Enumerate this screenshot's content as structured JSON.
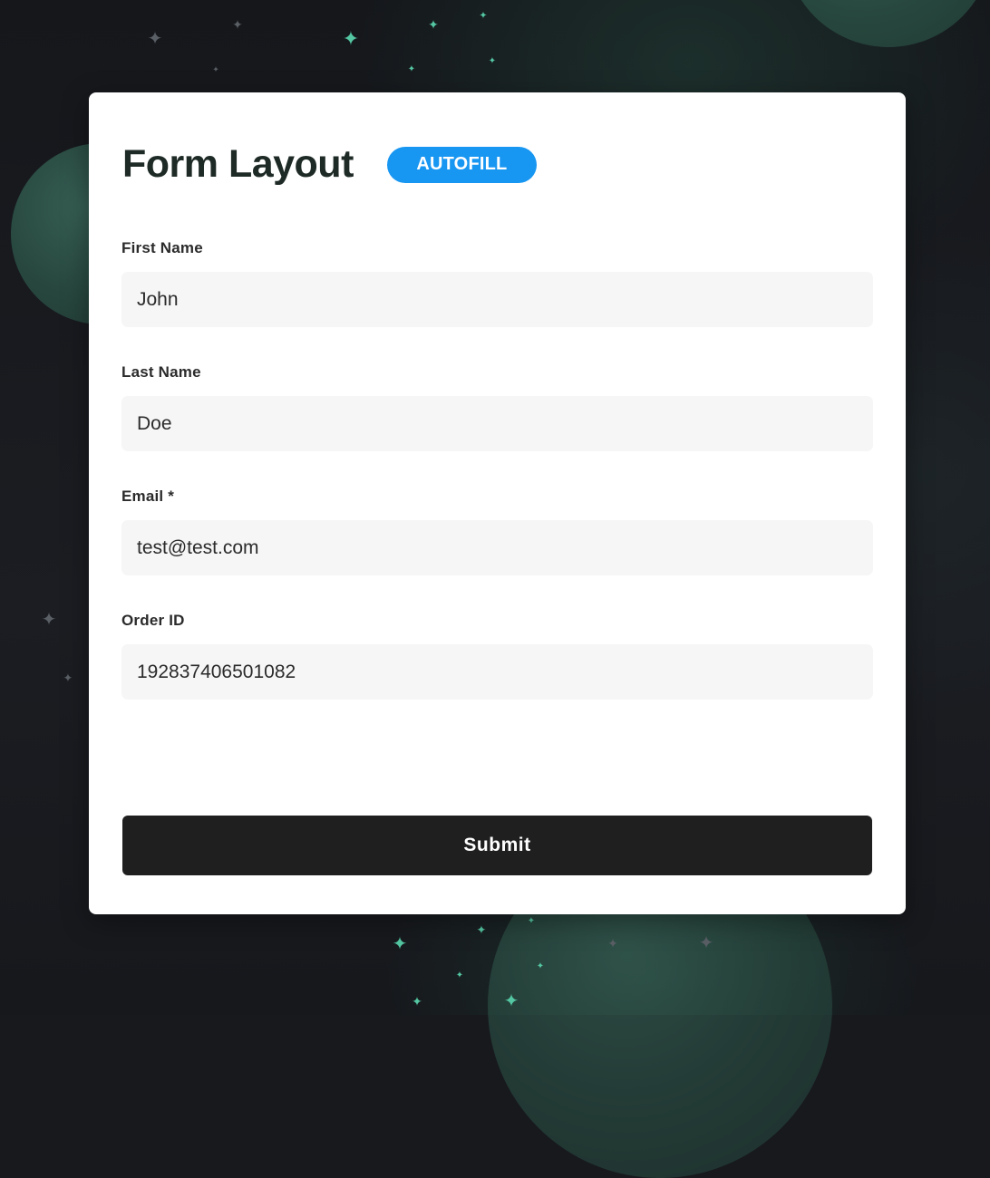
{
  "form": {
    "title": "Form Layout",
    "autofill_label": "AUTOFILL",
    "fields": [
      {
        "label": "First Name",
        "value": "John"
      },
      {
        "label": "Last Name",
        "value": "Doe"
      },
      {
        "label": "Email *",
        "value": "test@test.com"
      },
      {
        "label": "Order ID",
        "value": "192837406501082"
      }
    ],
    "submit_label": "Submit"
  },
  "theme": {
    "background": "#17191d",
    "card": "#ffffff",
    "accent_badge": "#1796f2",
    "button": "#1f1f1f",
    "input_bg": "#f6f6f6",
    "orb": "#2a4f44",
    "sparkle": "#54c7a2"
  }
}
